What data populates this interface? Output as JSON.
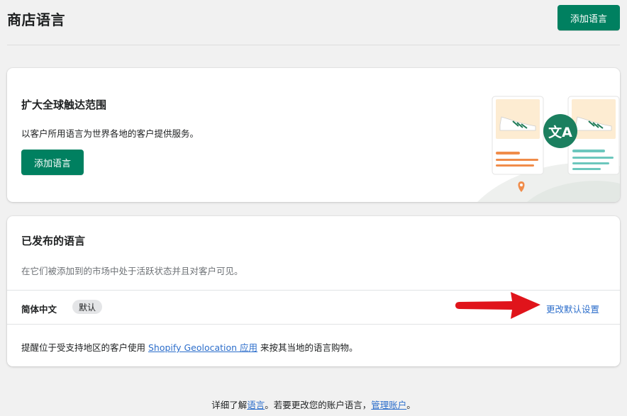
{
  "header": {
    "title": "商店语言",
    "add_button": "添加语言"
  },
  "promo": {
    "title": "扩大全球触达范围",
    "description": "以客户所用语言为世界各地的客户提供服务。",
    "add_button": "添加语言"
  },
  "published": {
    "title": "已发布的语言",
    "subtitle": "在它们被添加到的市场中处于活跃状态并且对客户可见。",
    "languages": [
      {
        "name": "简体中文",
        "badge": "默认",
        "action": "更改默认设置"
      }
    ],
    "geo_prefix": "提醒位于受支持地区的客户使用 ",
    "geo_link": "Shopify Geolocation 应用",
    "geo_suffix": " 来按其当地的语言购物。"
  },
  "footer": {
    "prefix": "详细了解",
    "link1": "语言",
    "middle": "。若要更改您的账户语言，",
    "link2": "管理账户",
    "suffix": "。"
  },
  "colors": {
    "primary": "#008060",
    "link": "#2c6ecb",
    "arrow": "#e0141b"
  }
}
